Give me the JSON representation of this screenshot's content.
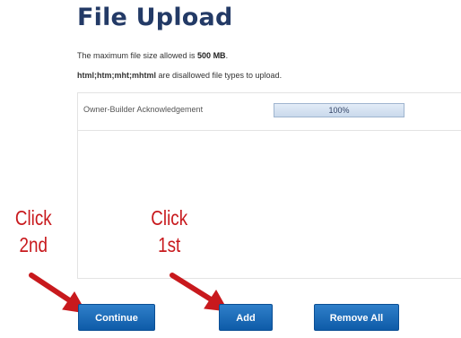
{
  "page": {
    "title": "File Upload",
    "max_size_text": "The maximum file size allowed is ",
    "max_size_value": "500 MB",
    "max_size_suffix": ".",
    "disallowed_types": "html;htm;mht;mhtml",
    "disallowed_suffix": " are disallowed file types to upload."
  },
  "upload": {
    "files": [
      {
        "name": "Owner-Builder Acknowledgement",
        "progress_label": "100%",
        "progress": 1.0
      }
    ]
  },
  "annotations": {
    "click_second": [
      "Click",
      "2nd"
    ],
    "click_first": [
      "Click",
      "1st"
    ],
    "color": "#c8191d"
  },
  "buttons": {
    "continue": "Continue",
    "add": "Add",
    "remove_all": "Remove All"
  },
  "colors": {
    "title": "#233a66",
    "button": "#1a6cbb"
  }
}
